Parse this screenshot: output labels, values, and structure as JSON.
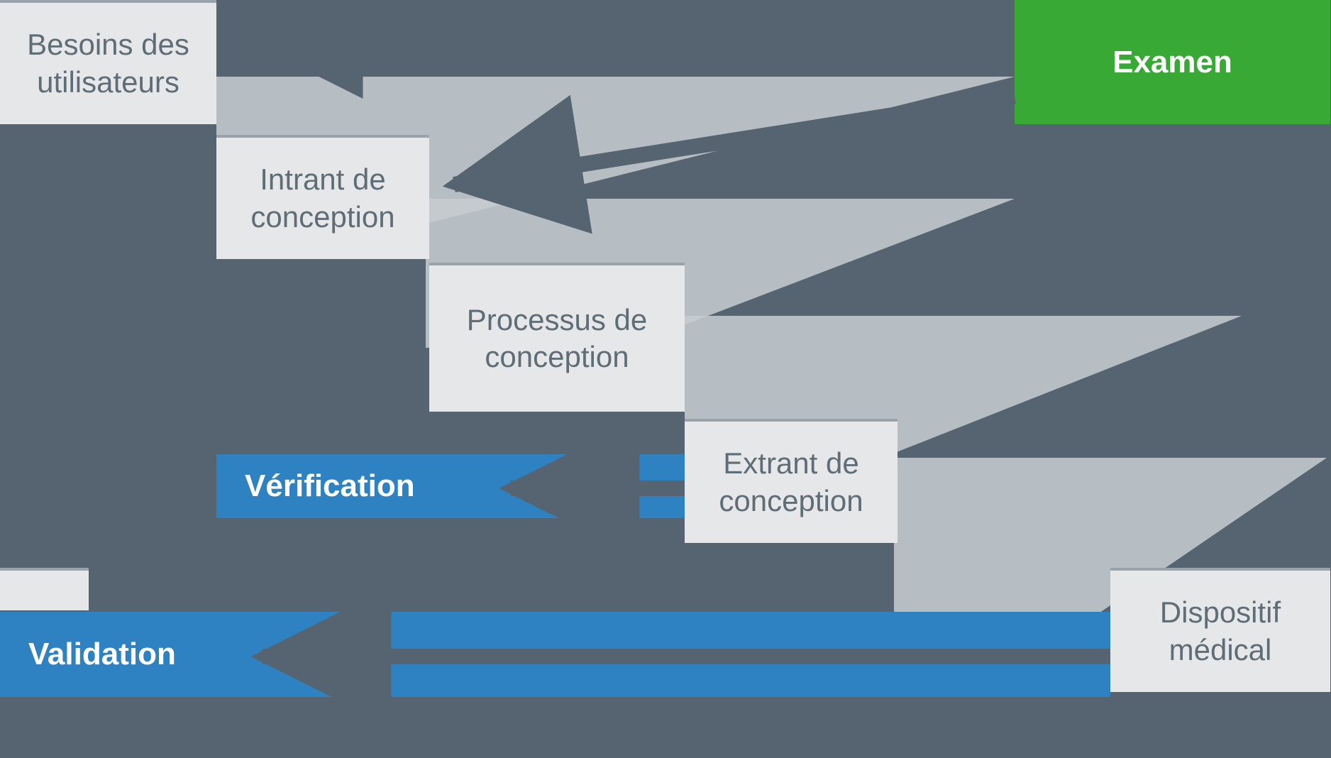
{
  "boxes": {
    "user_needs": "Besoins des utilisateurs",
    "design_input": "Intrant de conception",
    "design_process": "Processus de conception",
    "design_output": "Extrant de conception",
    "medical_device": "Dispositif médical",
    "review": "Examen",
    "verification": "Vérification",
    "validation": "Validation"
  }
}
